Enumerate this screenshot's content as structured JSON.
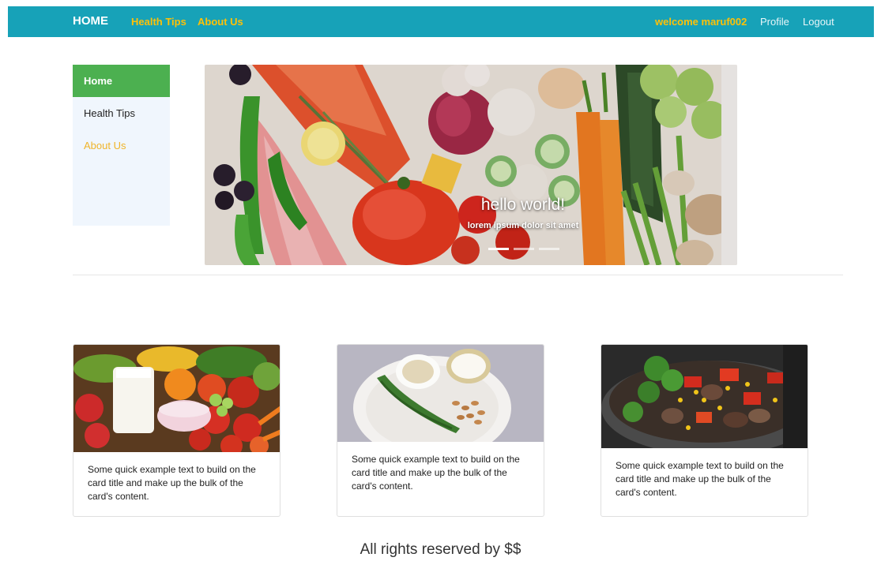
{
  "navbar": {
    "brand": "HOME",
    "links": [
      "Health Tips",
      "About Us"
    ],
    "welcome": "welcome maruf002",
    "profile": "Profile",
    "logout": "Logout",
    "bg_color": "#17a2b8",
    "link_color": "#ffc107"
  },
  "sidebar": {
    "items": [
      {
        "label": "Home",
        "active": true
      },
      {
        "label": "Health Tips",
        "active": false
      },
      {
        "label": "About Us",
        "active": false
      }
    ],
    "active_color": "#4cb050"
  },
  "carousel": {
    "caption_title": "hello world!",
    "caption_text": "lorem ipsum dolor sit amet",
    "slide_count": 3,
    "active_slide": 1
  },
  "cards": [
    {
      "image": "fruits-milk-yogurt-photo",
      "text": "Some quick example text to build on the card title and make up the bulk of the card's content."
    },
    {
      "image": "plate-grains-milk-almonds-photo",
      "text": "Some quick example text to build on the card title and make up the bulk of the card's content."
    },
    {
      "image": "roasted-vegetables-pan-photo",
      "text": "Some quick example text to build on the card title and make up the bulk of the card's content."
    }
  ],
  "footer": "All rights reserved by $$"
}
